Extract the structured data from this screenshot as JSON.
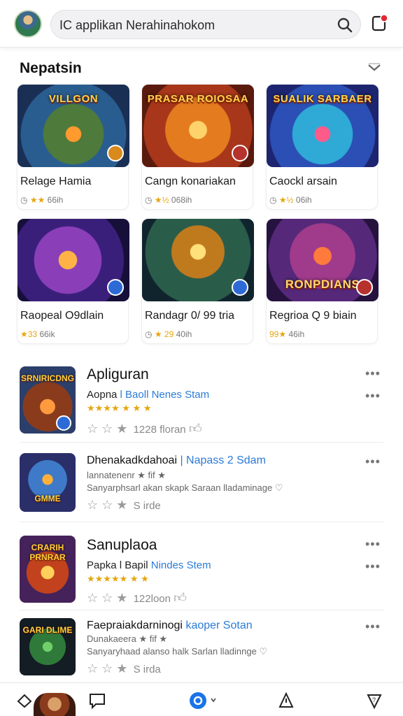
{
  "header": {
    "search_text": "IC applikan Nerahinahokom",
    "icons": {
      "avatar": "user-avatar",
      "search": "search-icon",
      "notification": "bell-icon"
    }
  },
  "section": {
    "title": "Nepatsin",
    "chevron": "chevron-down-icon"
  },
  "grid": [
    {
      "art_title": "VILLGON",
      "name": "Relage Hamia",
      "rating_stars": "★★",
      "meta": "66ih",
      "badge_color": "#d98a1d"
    },
    {
      "art_title": "PRASAR ROIOSAA",
      "name": "Cangn konariakan",
      "rating_stars": "★½",
      "meta": "068ih",
      "badge_color": "#b6322d"
    },
    {
      "art_title": "SUALIK SARBAER",
      "name": "Caockl arsain",
      "rating_stars": "★½",
      "meta": "06ih",
      "badge_color": "#2d6ad6"
    },
    {
      "art_title": "",
      "name": "Raopeal O9dlain",
      "rating_stars": "★33",
      "meta": "66ik",
      "badge_color": "#2d6ad6"
    },
    {
      "art_title": "",
      "name": "Randagr 0/ 99 tria",
      "rating_stars": "★ 29",
      "meta": "40ih",
      "badge_color": "#2d6ad6"
    },
    {
      "art_title": "RONPDIANS",
      "name": "Regrioa Q 9 biain",
      "rating_stars": "99★",
      "meta": "46ih",
      "badge_color": "#b6322d"
    }
  ],
  "list": [
    {
      "thumb_text": "SRNIRICDNG",
      "title": "Apliguran",
      "subtitle_plain": "Aopna",
      "subtitle_link": "l Baoll Nenes Stam",
      "stars": "★★★★ ★ ★ ★",
      "rating_text": "1228 floran",
      "more": "•••"
    },
    {
      "thumb_text": "GMME",
      "title": "Dhenakadkdahoai",
      "title_link": "| Napass 2 Sdam",
      "line1": "lannatenenr  ★ fif ★",
      "line2": "Sanyarphsarl akan skapk Saraan lladaminage ♡",
      "rating_text": "S irde",
      "more": "•••"
    },
    {
      "thumb_text": "CRARIH PRNRAR",
      "title": "Sanuplaoa",
      "subtitle_plain": "Papka l Bapil",
      "subtitle_link": "Nindes Stem",
      "stars": "★★★★★ ★ ★",
      "rating_text": "122loon",
      "more": "•••"
    },
    {
      "thumb_text": "GARI DLIME",
      "title": "Faepraiakdarninogi",
      "title_link": "kaoper Sotan",
      "line1": "Dunakaeera  ★ fif ★",
      "line2": "Sanyaryhaad alanso halk Sarlan lladinnge ♡",
      "rating_text": "S irda",
      "more": "•••"
    }
  ],
  "bottom_nav": {
    "icons": [
      "home-icon",
      "chat-icon",
      "messenger-icon",
      "alert-icon",
      "shield-icon"
    ]
  },
  "colors": {
    "accent": "#2b7bd6",
    "star": "#e5a60d"
  }
}
